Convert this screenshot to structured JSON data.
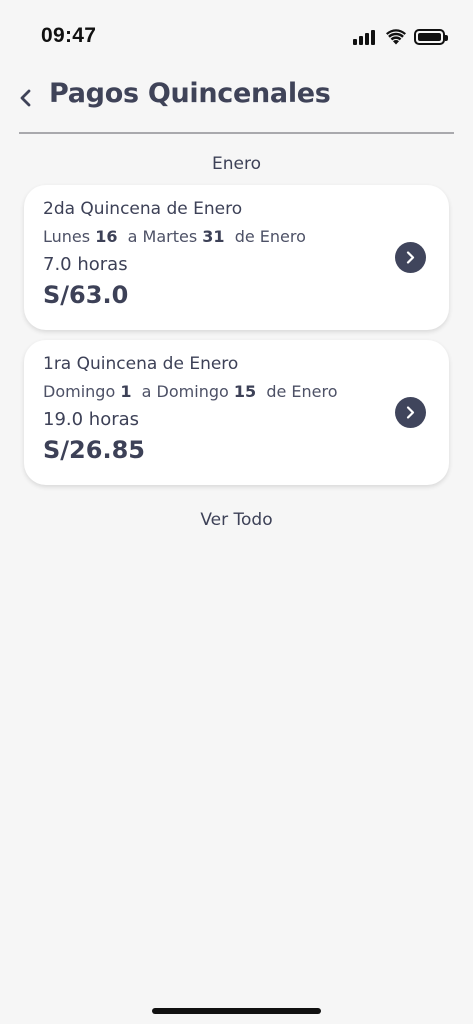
{
  "status_bar": {
    "time": "09:47"
  },
  "header": {
    "title": "Pagos Quincenales"
  },
  "month": "Enero",
  "periods": [
    {
      "title": "2da Quincena de Enero",
      "start_weekday": "Lunes",
      "start_day": "16",
      "connector": "a",
      "end_weekday": "Martes",
      "end_day": "31",
      "month_suffix": "de Enero",
      "hours": "7.0 horas",
      "amount": "S/63.0"
    },
    {
      "title": "1ra Quincena de Enero",
      "start_weekday": "Domingo",
      "start_day": "1",
      "connector": "a",
      "end_weekday": "Domingo",
      "end_day": "15",
      "month_suffix": "de Enero",
      "hours": "19.0 horas",
      "amount": "S/26.85"
    }
  ],
  "see_all_label": "Ver Todo",
  "icons": {
    "back": "chevron-left-icon",
    "card_arrow": "chevron-right-circle-icon",
    "signal": "cellular-signal-icon",
    "wifi": "wifi-icon",
    "battery": "battery-icon"
  },
  "colors": {
    "background": "#f6f6f6",
    "text": "#3d4157",
    "card": "#ffffff",
    "chevron_bg": "#40455c"
  }
}
